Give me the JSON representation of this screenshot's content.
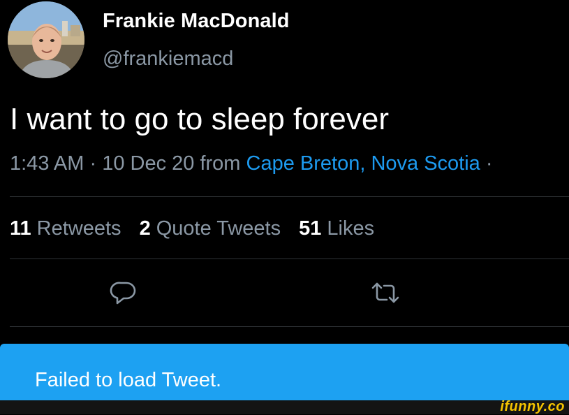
{
  "author": {
    "name": "Frankie MacDonald",
    "handle": "@frankiemacd",
    "avatar_icon": "profile-photo"
  },
  "tweet": {
    "text": "I want to go to sleep forever",
    "time": "1:43 AM",
    "separator": " · ",
    "date": "10 Dec 20",
    "from_label": " from ",
    "location": "Cape Breton, Nova Scotia",
    "trailing": " ·"
  },
  "stats": [
    {
      "count": "11",
      "label": "Retweets"
    },
    {
      "count": "2",
      "label": "Quote Tweets"
    },
    {
      "count": "51",
      "label": "Likes"
    }
  ],
  "actions": {
    "reply_icon": "reply-icon",
    "retweet_icon": "retweet-icon"
  },
  "banner": {
    "text": "Failed to load Tweet."
  },
  "watermark": {
    "text": "ifunny.co"
  },
  "colors": {
    "background": "#000000",
    "muted": "#8b98a5",
    "link": "#1d9bf0",
    "banner": "#1da1f2",
    "watermark": "#f5c400"
  }
}
